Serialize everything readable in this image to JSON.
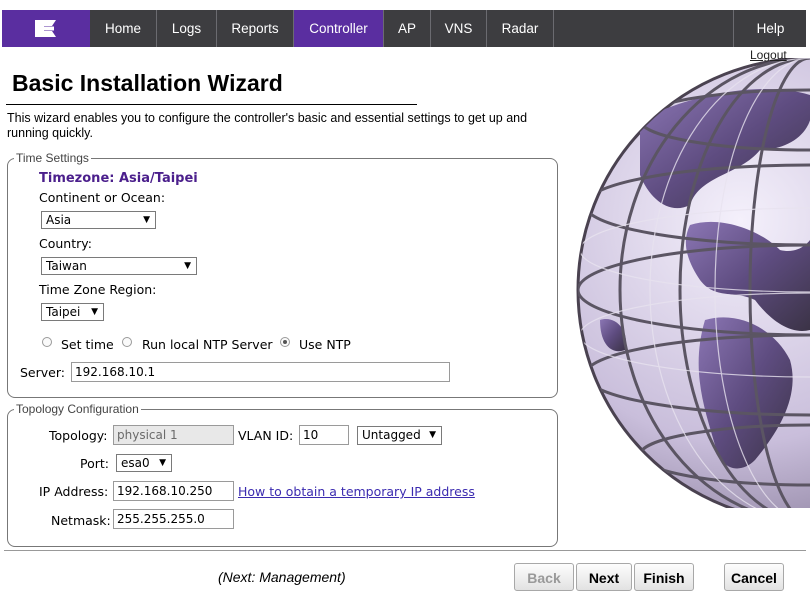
{
  "nav": {
    "logo_icon": "extreme-networks-logo",
    "tabs": [
      {
        "label": "Home"
      },
      {
        "label": "Logs"
      },
      {
        "label": "Reports"
      },
      {
        "label": "Controller"
      },
      {
        "label": "AP"
      },
      {
        "label": "VNS"
      },
      {
        "label": "Radar"
      }
    ],
    "help_label": "Help",
    "logout_label": "Logout"
  },
  "page": {
    "title": "Basic Installation Wizard",
    "intro": "This wizard enables you to configure the controller's basic and essential settings to get up and running quickly."
  },
  "time_settings": {
    "legend": "Time Settings",
    "timezone_label": "Timezone: Asia/Taipei",
    "continent_label": "Continent or Ocean:",
    "continent_value": "Asia",
    "country_label": "Country:",
    "country_value": "Taiwan",
    "region_label": "Time Zone Region:",
    "region_value": "Taipei",
    "time_mode_options": [
      "Set time",
      "Run local NTP Server",
      "Use NTP"
    ],
    "time_mode_selected": "Use NTP",
    "server_label": "Server:",
    "server_value": "192.168.10.1"
  },
  "topology": {
    "legend": "Topology Configuration",
    "topology_label": "Topology:",
    "topology_value": "physical 1",
    "vlan_label": "VLAN ID:",
    "vlan_value": "10",
    "tagging_value": "Untagged",
    "port_label": "Port:",
    "port_value": "esa0",
    "ip_label": "IP Address:",
    "ip_value": "192.168.10.250",
    "ip_help_link": "How to obtain a temporary IP address",
    "netmask_label": "Netmask:",
    "netmask_value": "255.255.255.0"
  },
  "footer": {
    "next_hint": "(Next: Management)",
    "back_label": "Back",
    "next_label": "Next",
    "finish_label": "Finish",
    "cancel_label": "Cancel"
  },
  "colors": {
    "nav_bg": "#3d3d40",
    "accent_purple": "#5a2ea0",
    "timezone_text": "#4b1f8c",
    "link": "#3b2bb0"
  }
}
